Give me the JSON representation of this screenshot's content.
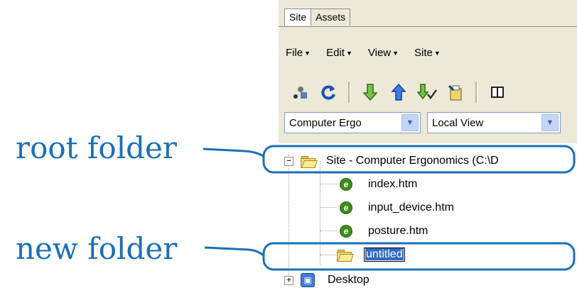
{
  "annotations": {
    "root_label": "root folder",
    "new_label": "new folder"
  },
  "tabs": [
    {
      "label": "Site",
      "active": true
    },
    {
      "label": "Assets",
      "active": false
    }
  ],
  "menu": [
    "File",
    "Edit",
    "View",
    "Site"
  ],
  "toolbar": [
    "connect-icon",
    "refresh-icon",
    "get-files-icon",
    "put-files-icon",
    "check-out-icon",
    "check-in-icon",
    "expand-icon"
  ],
  "selects": {
    "site": "Computer Ergo",
    "view": "Local View"
  },
  "tree": {
    "root": "Site - Computer Ergonomics (C:\\D",
    "files": [
      "index.htm",
      "input_device.htm",
      "posture.htm"
    ],
    "new_folder": "untitled",
    "desktop": "Desktop"
  },
  "colors": {
    "accent": "#1a6fb8",
    "panel": "#ece9d8",
    "selection": "#316ac5"
  }
}
